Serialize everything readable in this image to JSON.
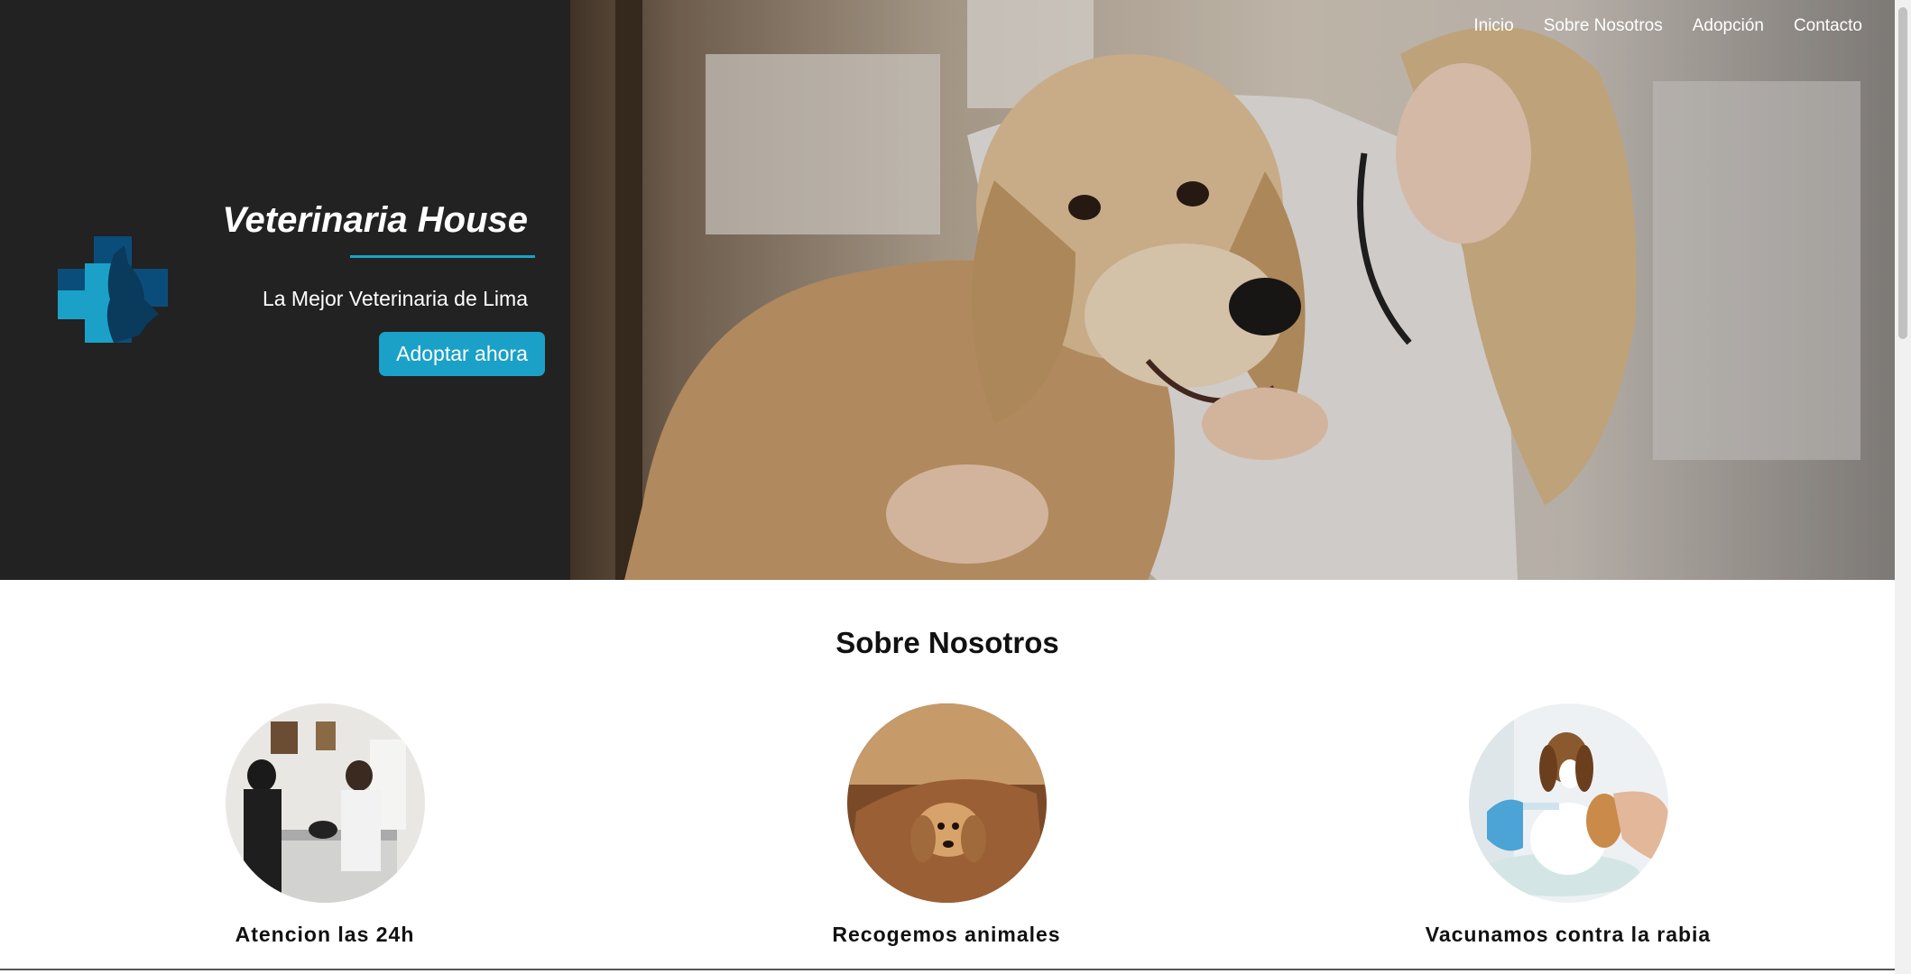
{
  "hero": {
    "title": "Veterinaria House",
    "tagline": "La Mejor Veterinaria de Lima",
    "cta_label": "Adoptar ahora"
  },
  "nav": {
    "items": [
      "Inicio",
      "Sobre Nosotros",
      "Adopción",
      "Contacto"
    ]
  },
  "about": {
    "title": "Sobre Nosotros",
    "cards": [
      {
        "label": "Atencion las 24h"
      },
      {
        "label": "Recogemos animales"
      },
      {
        "label": "Vacunamos contra la rabia"
      }
    ]
  },
  "colors": {
    "accent": "#1ba1c8",
    "dark_panel": "#222222",
    "logo_dark": "#0b4d7a"
  }
}
